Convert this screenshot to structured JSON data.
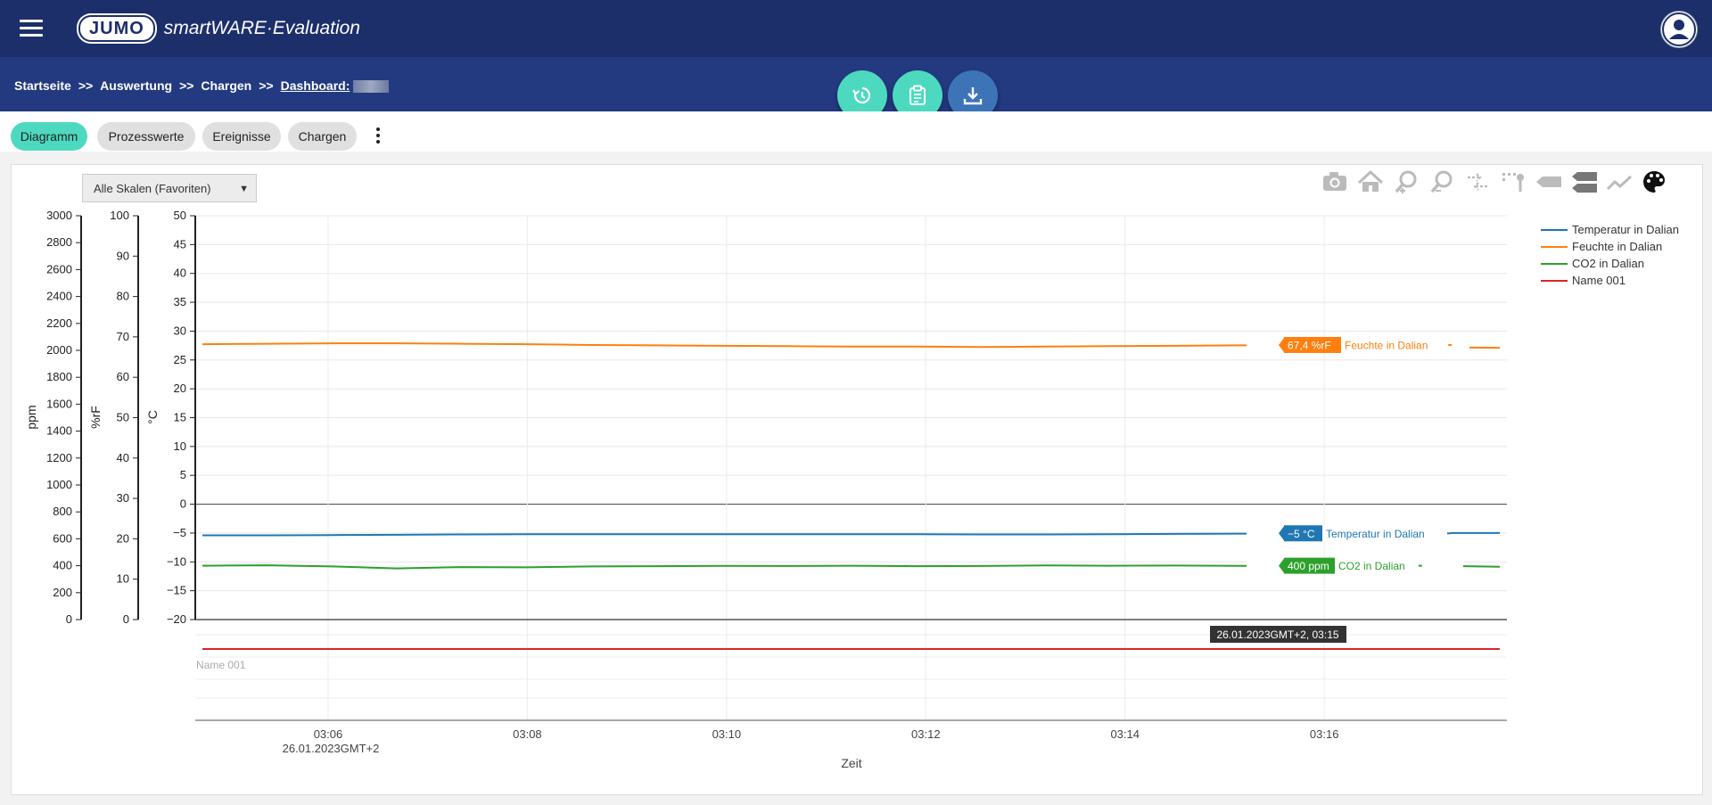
{
  "header": {
    "logo_badge": "JUMO",
    "logo_text": "smartWARE·Evaluation"
  },
  "breadcrumb": {
    "items": [
      "Startseite",
      "Auswertung",
      "Chargen"
    ],
    "separator": ">>",
    "current": "Dashboard:"
  },
  "tabs": [
    {
      "label": "Diagramm",
      "active": true
    },
    {
      "label": "Prozesswerte",
      "active": false
    },
    {
      "label": "Ereignisse",
      "active": false
    },
    {
      "label": "Chargen",
      "active": false
    }
  ],
  "scale_select": {
    "value": "Alle Skalen (Favoriten)"
  },
  "toolbar_icons": [
    "camera-icon",
    "home-icon",
    "zoom-in-icon",
    "zoom-out-icon",
    "pan-icon",
    "select-icon",
    "tag-icon",
    "tags-icon",
    "trend-icon",
    "palette-icon"
  ],
  "colors": {
    "accent": "#4dd9c0",
    "header": "#1c2f6b",
    "temperature": "#1f77b4",
    "humidity": "#ff7f0e",
    "co2": "#2ca02c",
    "name001": "#d62728"
  },
  "chart_data": {
    "type": "line",
    "xlabel": "Zeit",
    "x_ticks": [
      "03:06",
      "03:08",
      "03:10",
      "03:12",
      "03:14",
      "03:16"
    ],
    "x_date_label": "26.01.2023GMT+2",
    "x_range": [
      "03:04:40",
      "03:17:50"
    ],
    "axes": [
      {
        "unit": "ppm",
        "ylim": [
          0,
          3000
        ],
        "ticks": [
          "0",
          "200",
          "400",
          "600",
          "800",
          "1000",
          "1200",
          "1400",
          "1600",
          "1800",
          "2000",
          "2200",
          "2400",
          "2600",
          "2800",
          "3000"
        ]
      },
      {
        "unit": "%rF",
        "ylim": [
          0,
          100
        ],
        "ticks": [
          "0",
          "10",
          "20",
          "30",
          "40",
          "50",
          "60",
          "70",
          "80",
          "90",
          "100"
        ]
      },
      {
        "unit": "°C",
        "ylim": [
          -20,
          50
        ],
        "ticks": [
          "−20",
          "−15",
          "−10",
          "−5",
          "0",
          "5",
          "10",
          "15",
          "20",
          "25",
          "30",
          "35",
          "40",
          "45",
          "50"
        ]
      }
    ],
    "series": [
      {
        "name": "Temperatur in Dalian",
        "axis": "°C",
        "values": [
          -5.4,
          -5.4,
          -5.35,
          -5.3,
          -5.25,
          -5.2,
          -5.2,
          -5.2,
          -5.2,
          -5.2,
          -5.2,
          -5.2,
          -5.25,
          -5.25,
          -5.2,
          -5.15,
          -5.1,
          -5.05,
          -5.0,
          -5.0,
          -5.0
        ]
      },
      {
        "name": "Feuchte in Dalian",
        "axis": "%rF",
        "values": [
          68.2,
          68.3,
          68.4,
          68.4,
          68.3,
          68.2,
          68.0,
          67.9,
          67.8,
          67.7,
          67.6,
          67.6,
          67.5,
          67.6,
          67.7,
          67.8,
          67.9,
          68.0,
          67.6,
          67.4,
          67.3
        ]
      },
      {
        "name": "CO2 in Dalian",
        "axis": "ppm",
        "values": [
          400,
          403,
          395,
          380,
          390,
          388,
          395,
          397,
          399,
          398,
          400,
          397,
          398,
          402,
          400,
          401,
          399,
          400,
          400,
          400,
          392
        ]
      },
      {
        "name": "Name 001",
        "axis": "",
        "values": []
      }
    ],
    "value_labels": [
      {
        "text": "67,4 %rF",
        "series": "Feuchte in Dalian"
      },
      {
        "text": "−5 °C",
        "series": "Temperatur in Dalian"
      },
      {
        "text": "400 ppm",
        "series": "CO2 in Dalian"
      }
    ],
    "crosshair_label": "26.01.2023GMT+2, 03:15",
    "legend_placement": "top-right"
  }
}
